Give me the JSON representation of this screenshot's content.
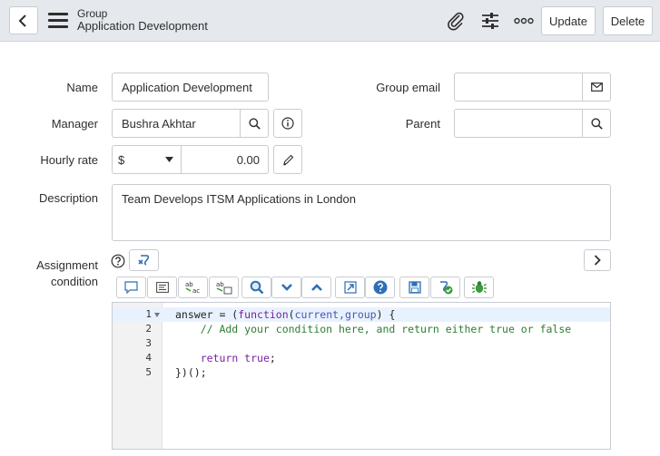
{
  "header": {
    "record_type": "Group",
    "record_name": "Application Development",
    "update_label": "Update",
    "delete_label": "Delete"
  },
  "form": {
    "name": {
      "label": "Name",
      "value": "Application Development"
    },
    "manager": {
      "label": "Manager",
      "value": "Bushra Akhtar"
    },
    "hourly_rate": {
      "label": "Hourly rate",
      "currency": "$",
      "amount": "0.00"
    },
    "group_email": {
      "label": "Group email",
      "value": ""
    },
    "parent": {
      "label": "Parent",
      "value": ""
    },
    "description": {
      "label": "Description",
      "value": "Team Develops ITSM Applications in London"
    },
    "assignment_condition": {
      "label_line1": "Assignment",
      "label_line2": "condition"
    }
  },
  "editor": {
    "line_numbers": [
      "1",
      "2",
      "3",
      "4",
      "5"
    ],
    "lines": {
      "l1_a": "answer = (",
      "l1_kw": "function",
      "l1_b": "(",
      "l1_params": "current,group",
      "l1_c": ") {",
      "l2": "    // Add your condition here, and return either true or false",
      "l4_kw": "return",
      "l4_val": " true",
      "l4_end": ";",
      "l5": "})();"
    }
  },
  "colors": {
    "header_bg": "#e5e8ec",
    "toolbar_blue": "#2f6fb5",
    "toolbar_green": "#3a9b3a"
  }
}
